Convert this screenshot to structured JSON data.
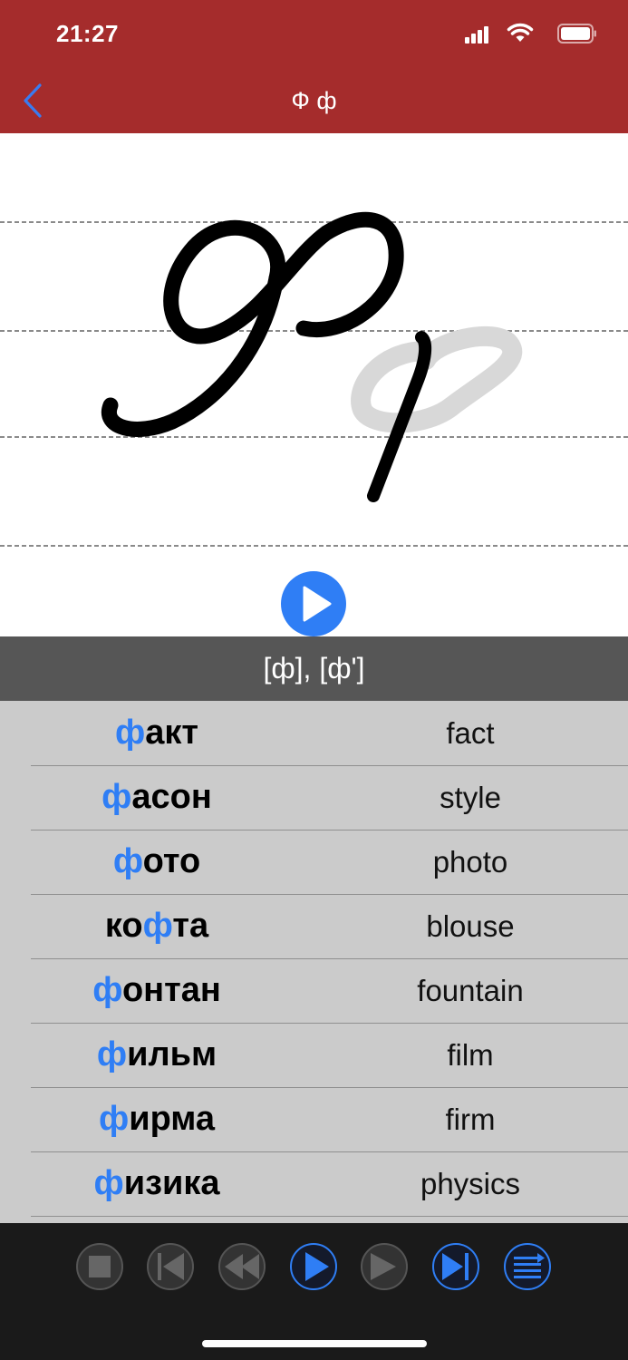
{
  "status_bar": {
    "time": "21:27"
  },
  "nav": {
    "title": "Ф ф",
    "back_icon": "chevron-left-icon"
  },
  "letter": {
    "uppercase": "Ф",
    "lowercase": "ф",
    "style": "cursive"
  },
  "sound": "[ф], [ф']",
  "words": [
    {
      "ru": "факт",
      "en": "fact"
    },
    {
      "ru": "фасон",
      "en": "style"
    },
    {
      "ru": "фото",
      "en": "photo"
    },
    {
      "ru": "кофта",
      "en": "blouse"
    },
    {
      "ru": "фонтан",
      "en": "fountain"
    },
    {
      "ru": "фильм",
      "en": "film"
    },
    {
      "ru": "фирма",
      "en": "firm"
    },
    {
      "ru": "физика",
      "en": "physics"
    }
  ],
  "colors": {
    "header": "#a52c2c",
    "accent": "#2f7ef5",
    "list_bg": "#cbcbcb",
    "sound_bar": "#565656",
    "player_bg": "#1a1a1a"
  },
  "player_controls": [
    {
      "name": "stop-button",
      "icon": "stop-icon",
      "active": false
    },
    {
      "name": "skip-to-start-button",
      "icon": "skip-start-icon",
      "active": false
    },
    {
      "name": "previous-button",
      "icon": "rewind-icon",
      "active": false
    },
    {
      "name": "play-button",
      "icon": "play-icon",
      "active": true
    },
    {
      "name": "next-button",
      "icon": "forward-icon",
      "active": false
    },
    {
      "name": "skip-to-end-button",
      "icon": "skip-end-icon",
      "active": true
    },
    {
      "name": "list-button",
      "icon": "list-icon",
      "active": true
    }
  ]
}
